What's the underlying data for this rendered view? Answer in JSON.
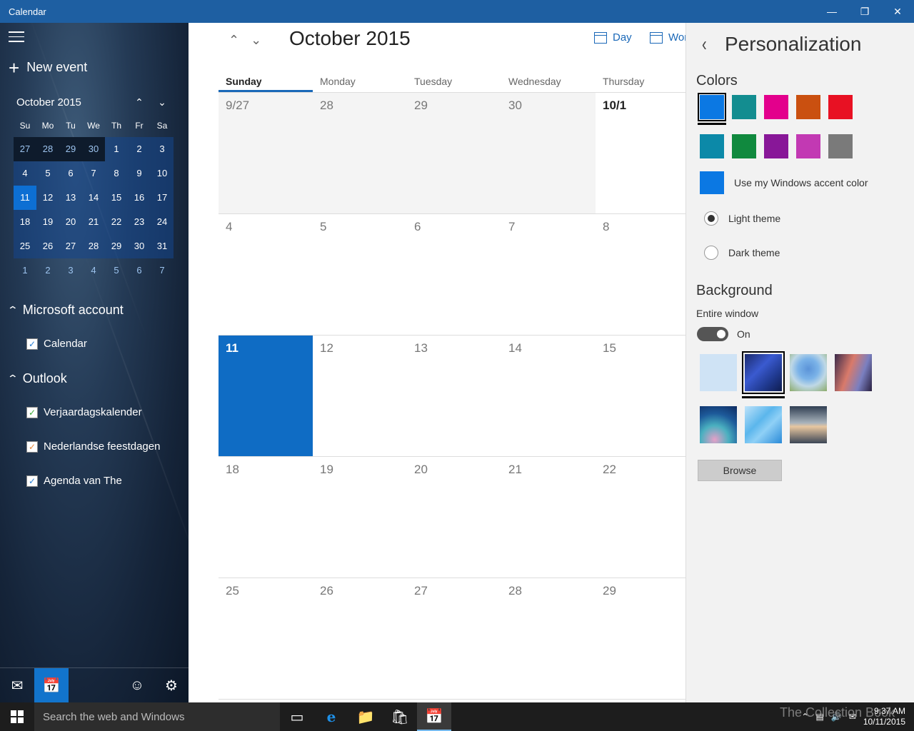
{
  "window": {
    "title": "Calendar"
  },
  "sidebar": {
    "new_event": "New event",
    "mini_calendar": {
      "title": "October 2015",
      "dow": [
        "Su",
        "Mo",
        "Tu",
        "We",
        "Th",
        "Fr",
        "Sa"
      ],
      "weeks": [
        [
          "27",
          "28",
          "29",
          "30",
          "1",
          "2",
          "3"
        ],
        [
          "4",
          "5",
          "6",
          "7",
          "8",
          "9",
          "10"
        ],
        [
          "11",
          "12",
          "13",
          "14",
          "15",
          "16",
          "17"
        ],
        [
          "18",
          "19",
          "20",
          "21",
          "22",
          "23",
          "24"
        ],
        [
          "25",
          "26",
          "27",
          "28",
          "29",
          "30",
          "31"
        ],
        [
          "1",
          "2",
          "3",
          "4",
          "5",
          "6",
          "7"
        ]
      ]
    },
    "accounts": [
      {
        "name": "Microsoft account",
        "calendars": [
          {
            "name": "Calendar",
            "color": "#2a7fd4"
          }
        ]
      },
      {
        "name": "Outlook",
        "calendars": [
          {
            "name": "Verjaardagskalender",
            "color": "#3aaa35"
          },
          {
            "name": "Nederlandse feestdagen",
            "color": "#e8883a"
          },
          {
            "name": "Agenda van The",
            "color": "#2a7fd4"
          }
        ]
      }
    ]
  },
  "main": {
    "month_title": "October 2015",
    "views": {
      "day": "Day",
      "work_week": "Wor"
    },
    "day_headers": [
      "Sunday",
      "Monday",
      "Tuesday",
      "Wednesday",
      "Thursday"
    ],
    "weeks": [
      [
        "9/27",
        "28",
        "29",
        "30",
        "10/1"
      ],
      [
        "4",
        "5",
        "6",
        "7",
        "8"
      ],
      [
        "11",
        "12",
        "13",
        "14",
        "15"
      ],
      [
        "18",
        "19",
        "20",
        "21",
        "22"
      ],
      [
        "25",
        "26",
        "27",
        "28",
        "29"
      ]
    ]
  },
  "panel": {
    "title": "Personalization",
    "colors_heading": "Colors",
    "colors": [
      "#0b78e3",
      "#138d90",
      "#e3008c",
      "#ca5010",
      "#e81123",
      "#0c89a8",
      "#10893e",
      "#881798",
      "#c239b3",
      "#7a7a7a"
    ],
    "accent_color": "#0b78e3",
    "accent_label": "Use my Windows accent color",
    "light_theme": "Light theme",
    "dark_theme": "Dark theme",
    "background_heading": "Background",
    "entire_window": "Entire window",
    "toggle_state": "On",
    "browse": "Browse"
  },
  "taskbar": {
    "search_placeholder": "Search the web and Windows",
    "time": "9:37 AM",
    "date": "10/11/2015",
    "watermark": "The Collection Book"
  }
}
